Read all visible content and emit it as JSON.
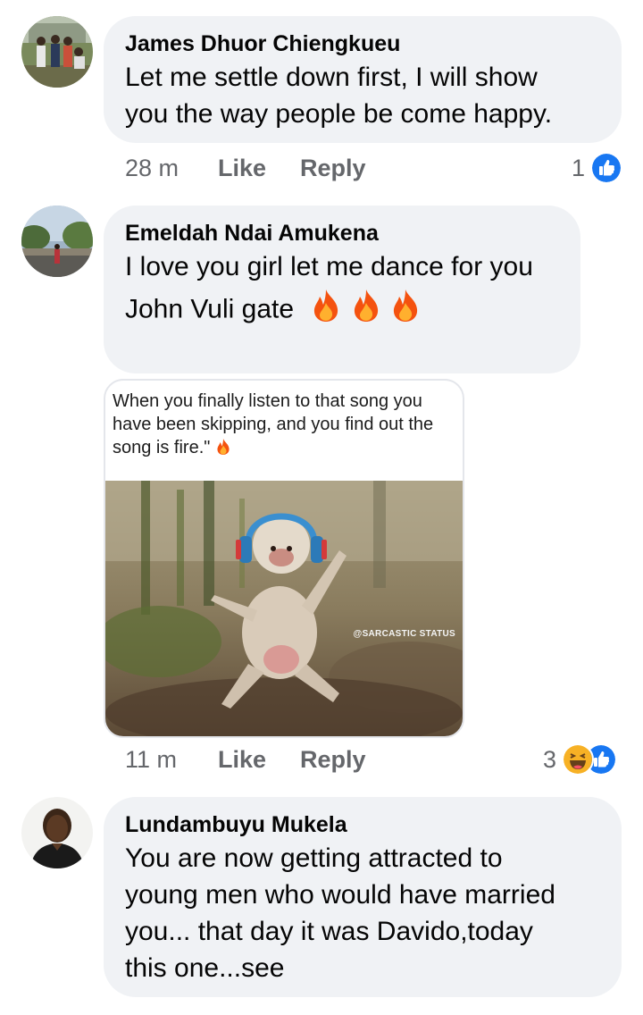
{
  "comments": [
    {
      "author": "James Dhuor Chiengkueu",
      "text_lines": [
        "Let me settle down first, I will show",
        "you the way people be come happy."
      ],
      "time": "28 m",
      "like_label": "Like",
      "reply_label": "Reply",
      "reaction_count": "1",
      "reactions": [
        "like"
      ]
    },
    {
      "author": "Emeldah Ndai Amukena",
      "text_lines": [
        "I love you girl let me dance for you",
        "John Vuli gate"
      ],
      "text_emoji": [
        "fire",
        "fire",
        "fire"
      ],
      "attachment": {
        "caption_lines": [
          "When you finally listen to that song you",
          "have been skipping, and you find out the",
          "song is fire.\""
        ],
        "caption_emoji": "fire",
        "watermark": "@SARCASTIC STATUS",
        "image": "baby-monkey-dancing-with-headphones"
      },
      "time": "11 m",
      "like_label": "Like",
      "reply_label": "Reply",
      "reaction_count": "3",
      "reactions": [
        "haha",
        "like"
      ]
    },
    {
      "author": "Lundambuyu Mukela",
      "text_lines": [
        "You are now getting attracted to",
        "young men who would have married",
        "you... that day it was Davido,today",
        "this one...see"
      ]
    }
  ],
  "colors": {
    "bubble": "#f0f2f5",
    "meta_text": "#65676b",
    "like_blue": "#1877f2",
    "haha_yellow": "#f7b125"
  }
}
